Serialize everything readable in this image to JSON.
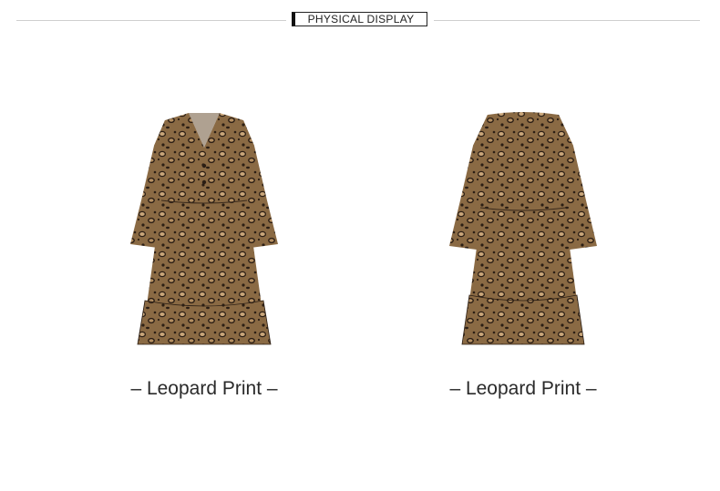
{
  "header": {
    "title": "PHYSICAL DISPLAY"
  },
  "products": [
    {
      "view": "front",
      "icon": "leopard-dress-front-icon",
      "caption": "– Leopard Print –"
    },
    {
      "view": "back",
      "icon": "leopard-dress-back-icon",
      "caption": "– Leopard Print –"
    }
  ],
  "colors": {
    "print_base": "#8a6a44",
    "print_spot": "#2b1e14",
    "print_light": "#c9a67a",
    "text": "#2a2a2a"
  }
}
